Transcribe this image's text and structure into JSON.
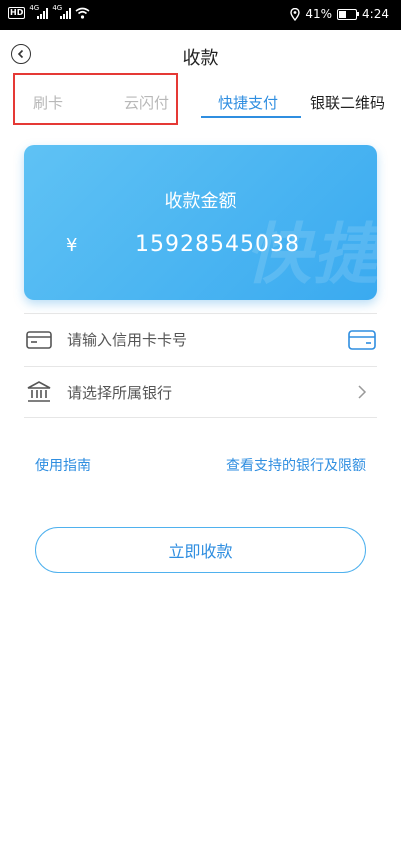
{
  "status_bar": {
    "left_badge": "HD",
    "net1": "4G",
    "net2": "4G",
    "battery_percent": "41%",
    "battery_level": 0.41,
    "time": "4:24"
  },
  "header": {
    "title": "收款"
  },
  "tabs": [
    {
      "label": "刷卡",
      "state": "disabled"
    },
    {
      "label": "云闪付",
      "state": "disabled"
    },
    {
      "label": "快捷支付",
      "state": "active"
    },
    {
      "label": "银联二维码",
      "state": "normal"
    }
  ],
  "card": {
    "title": "收款金额",
    "currency": "¥",
    "amount": "15928545038",
    "watermark": "快捷"
  },
  "form": {
    "card_number_placeholder": "请输入信用卡卡号",
    "bank_placeholder": "请选择所属银行"
  },
  "links": {
    "guide": "使用指南",
    "supported_banks": "查看支持的银行及限额"
  },
  "submit": {
    "label": "立即收款"
  },
  "colors": {
    "accent": "#2f8ee0",
    "card_gradient_start": "#5fc2f4",
    "card_gradient_end": "#3aaaf0",
    "highlight_box": "#e53935"
  }
}
